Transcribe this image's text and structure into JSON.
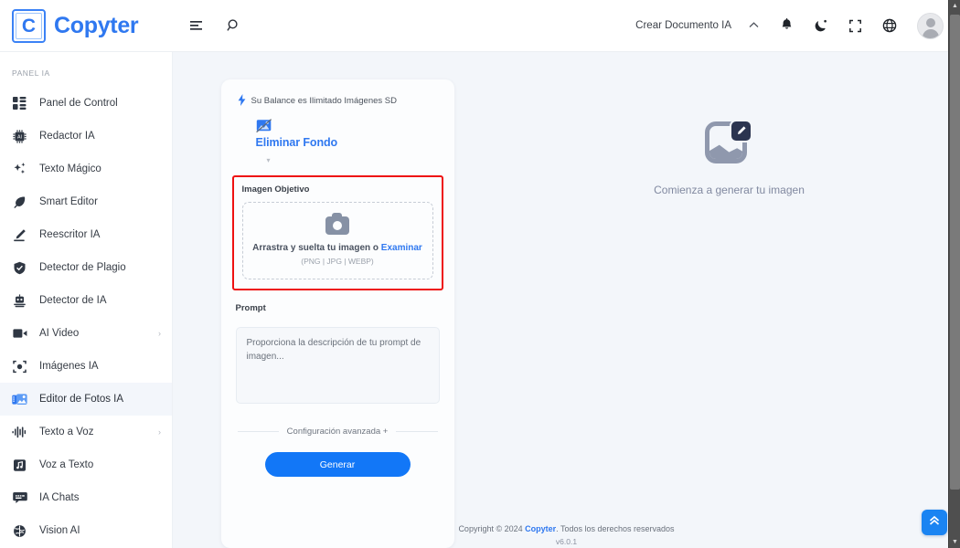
{
  "brand": {
    "mark_letter": "C",
    "name": "Copyter"
  },
  "topbar": {
    "menu_icon": "menu-lines-icon",
    "search_icon": "search-icon",
    "create_document_label": "Crear Documento IA",
    "chevron_label": "⌃",
    "notifications_icon": "bell-icon",
    "theme_icon": "moon-icon",
    "fullscreen_icon": "fullscreen-icon",
    "language_icon": "globe-icon",
    "avatar_icon": "user-avatar"
  },
  "sidebar": {
    "section_title": "PANEL IA",
    "items": [
      {
        "label": "Panel de Control",
        "icon": "dashboard-icon",
        "active": false,
        "chevron": ""
      },
      {
        "label": "Redactor IA",
        "icon": "chip-ai-icon",
        "active": false,
        "chevron": ""
      },
      {
        "label": "Texto Mágico",
        "icon": "sparkles-icon",
        "active": false,
        "chevron": ""
      },
      {
        "label": "Smart Editor",
        "icon": "feather-icon",
        "active": false,
        "chevron": ""
      },
      {
        "label": "Reescritor IA",
        "icon": "pencil-icon",
        "active": false,
        "chevron": ""
      },
      {
        "label": "Detector de Plagio",
        "icon": "shield-icon",
        "active": false,
        "chevron": ""
      },
      {
        "label": "Detector de IA",
        "icon": "robot-icon",
        "active": false,
        "chevron": ""
      },
      {
        "label": "AI Video",
        "icon": "video-camera-icon",
        "active": false,
        "chevron": "›"
      },
      {
        "label": "Imágenes IA",
        "icon": "image-frame-icon",
        "active": false,
        "chevron": ""
      },
      {
        "label": "Editor de Fotos IA",
        "icon": "photo-editor-icon",
        "active": true,
        "chevron": ""
      },
      {
        "label": "Texto a Voz",
        "icon": "waveform-icon",
        "active": false,
        "chevron": "›"
      },
      {
        "label": "Voz a Texto",
        "icon": "music-note-icon",
        "active": false,
        "chevron": ""
      },
      {
        "label": "IA Chats",
        "icon": "chat-bubble-icon",
        "active": false,
        "chevron": ""
      },
      {
        "label": "Vision AI",
        "icon": "brain-icon",
        "active": false,
        "chevron": ""
      }
    ]
  },
  "card": {
    "balance_icon": "bolt-icon",
    "balance_text": "Su Balance es Ilimitado Imágenes SD",
    "tool_icon": "remove-background-icon",
    "tool_name": "Eliminar Fondo",
    "tool_caret": "▾",
    "target_image": {
      "label": "Imagen Objetivo",
      "dropzone_icon": "camera-icon",
      "dropzone_text": "Arrastra y suelta tu imagen o",
      "dropzone_browse": "Examinar",
      "dropzone_formats": "(PNG | JPG | WEBP)",
      "highlight_color": "#ee1111"
    },
    "prompt": {
      "label": "Prompt",
      "placeholder": "Proporciona la descripción de tu prompt de imagen...",
      "value": ""
    },
    "advanced_label": "Configuración avanzada +",
    "generate_label": "Generar",
    "accent_color": "#1277f7"
  },
  "placeholder": {
    "icon": "image-edit-icon",
    "text": "Comienza a generar tu imagen"
  },
  "footer": {
    "copyright_prefix": "Copyright © 2024",
    "brand": "Copyter",
    "copyright_suffix": ". Todos los derechos reservados",
    "version": "v6.0.1"
  },
  "fab": {
    "icon": "double-chevron-up-icon",
    "color": "#1a84f2"
  }
}
